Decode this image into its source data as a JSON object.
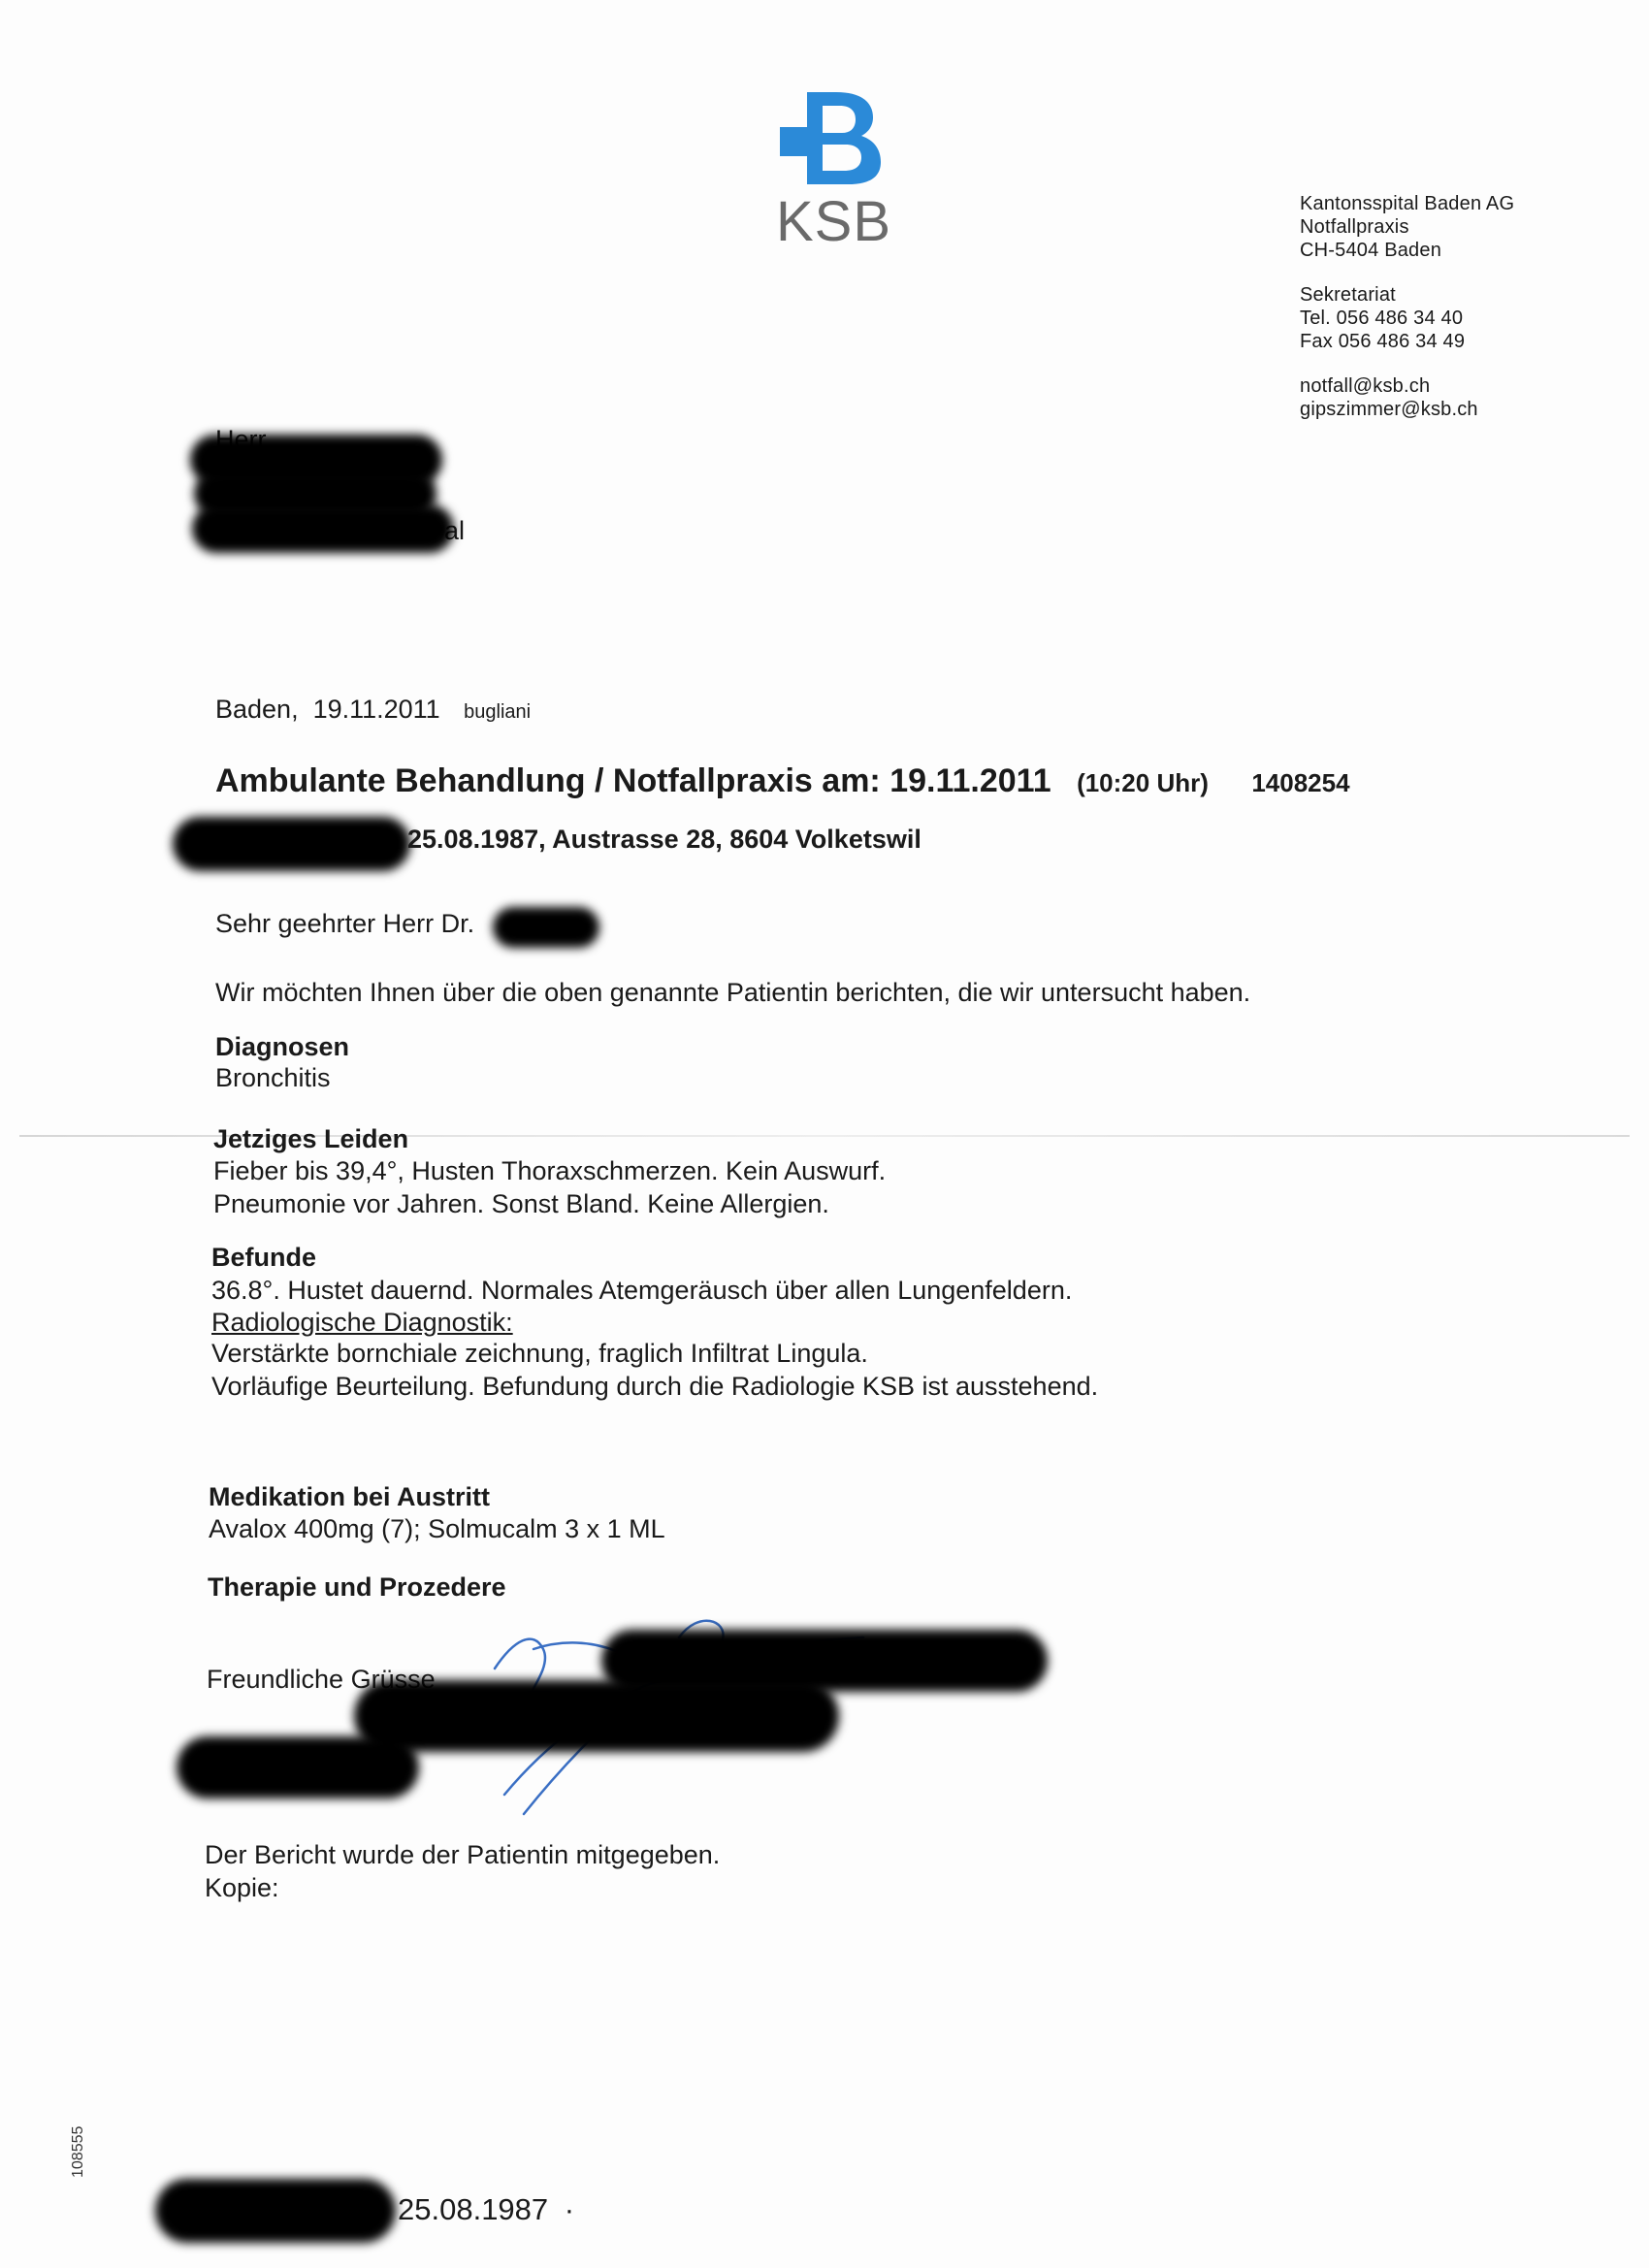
{
  "header": {
    "logo_text": "KSB",
    "brand_color": "#2b8ad8",
    "logo_gray": "#6a6a6a",
    "sender": {
      "line1": "Kantonsspital Baden AG",
      "line2": "Notfallpraxis",
      "line3": "CH-5404 Baden",
      "line4": "Sekretariat",
      "line5": "Tel. 056 486 34 40",
      "line6": "Fax 056 486 34 49",
      "line7": "notfall@ksb.ch",
      "line8": "gipszimmer@ksb.ch"
    }
  },
  "recipient": {
    "salutation": "Herr",
    "visible_fragment": "al"
  },
  "dateline": {
    "place_date": "Baden,  19.11.2011",
    "author": "bugliani"
  },
  "title": {
    "main": "Ambulante Behandlung / Notfallpraxis am: 19.11.2011",
    "time": "(10:20 Uhr)",
    "number": "1408254"
  },
  "patient_line": "25.08.1987, Austrasse 28, 8604 Volketswil",
  "greeting": "Sehr geehrter Herr Dr.",
  "intro": "Wir möchten Ihnen über die oben genannte Patientin berichten, die wir untersucht haben.",
  "sections": {
    "diagnosen": {
      "heading": "Diagnosen",
      "lines": [
        "Bronchitis"
      ]
    },
    "leiden": {
      "heading": "Jetziges Leiden",
      "lines": [
        "Fieber bis 39,4°, Husten Thoraxschmerzen. Kein Auswurf.",
        "Pneumonie vor Jahren. Sonst Bland. Keine Allergien."
      ]
    },
    "befunde": {
      "heading": "Befunde",
      "line1": "36.8°. Hustet dauernd. Normales Atemgeräusch über allen Lungenfeldern.",
      "sub_heading": "Radiologische Diagnostik:",
      "line2": "Verstärkte bornchiale zeichnung, fraglich Infiltrat Lingula.",
      "line3": "Vorläufige Beurteilung. Befundung durch die Radiologie KSB ist ausstehend."
    },
    "medikation": {
      "heading": "Medikation bei Austritt",
      "lines": [
        "Avalox 400mg (7); Solmucalm 3 x 1 ML"
      ]
    },
    "therapie": {
      "heading": "Therapie und Prozedere"
    }
  },
  "closing": {
    "greeting": "Freundliche Grüsse",
    "note": "Der Bericht wurde der Patientin mitgegeben.",
    "copy": "Kopie:"
  },
  "footer": {
    "side_number": "108555",
    "date": "25.08.1987",
    "dot": "·"
  },
  "signature_color": "#3a6fc4"
}
